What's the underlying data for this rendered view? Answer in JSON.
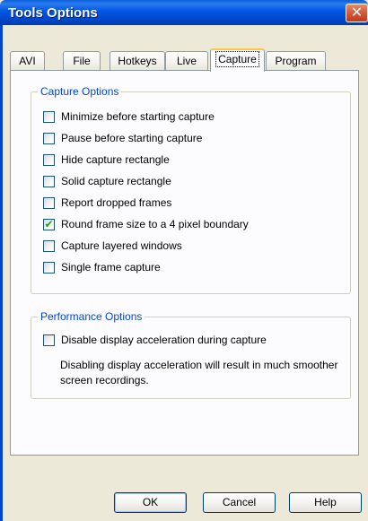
{
  "window": {
    "title": "Tools Options",
    "close_glyph": "✕"
  },
  "tabs": [
    {
      "label": "AVI"
    },
    {
      "label": "File"
    },
    {
      "label": "Hotkeys"
    },
    {
      "label": "Live"
    },
    {
      "label": "Capture",
      "selected": true
    },
    {
      "label": "Program"
    }
  ],
  "capture_options": {
    "title": "Capture Options",
    "items": [
      {
        "label": "Minimize before starting capture",
        "checked": false
      },
      {
        "label": "Pause before starting capture",
        "checked": false
      },
      {
        "label": "Hide capture rectangle",
        "checked": false
      },
      {
        "label": "Solid capture rectangle",
        "checked": false
      },
      {
        "label": "Report dropped frames",
        "checked": false
      },
      {
        "label": "Round frame size to a 4 pixel boundary",
        "checked": true
      },
      {
        "label": "Capture layered windows",
        "checked": false
      },
      {
        "label": "Single frame capture",
        "checked": false
      }
    ]
  },
  "performance_options": {
    "title": "Performance Options",
    "item": {
      "label": "Disable display acceleration during capture",
      "checked": false
    },
    "note": "Disabling display acceleration will result in much smoother screen recordings."
  },
  "buttons": {
    "ok": "OK",
    "cancel": "Cancel",
    "help": "Help"
  },
  "colors": {
    "titlebar": "#0055e5",
    "group_title": "#0046d5",
    "active_tab_accent": "#ffc83c",
    "check": "#21a121"
  }
}
